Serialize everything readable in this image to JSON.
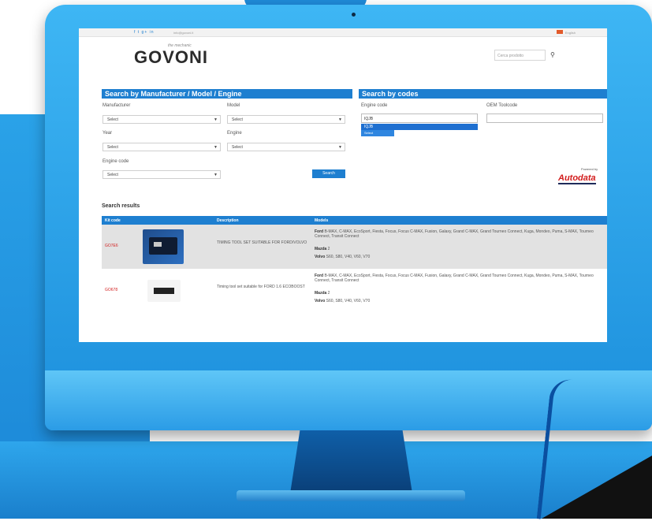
{
  "topbar": {
    "social_icons": "f t g+ in",
    "contact_text": "info@govoni.it",
    "language_text": "English"
  },
  "header": {
    "logo_text": "GOVONI",
    "logo_tagline": "the mechanic",
    "search_placeholder": "Cerca prodotto"
  },
  "search_manufacturer": {
    "title": "Search by Manufacturer / Model / Engine",
    "manufacturer_label": "Manufacturer",
    "manufacturer_value": "Select",
    "model_label": "Model",
    "model_value": "Select",
    "year_label": "Year",
    "year_value": "Select",
    "engine_label": "Engine",
    "engine_value": "Select",
    "engine_code_label": "Engine code",
    "engine_code_value": "Select",
    "search_button": "Search"
  },
  "search_codes": {
    "title": "Search by codes",
    "engine_code_label": "Engine code",
    "engine_code_value": "IQJB",
    "suggestion_1": "IQJB",
    "suggestion_2": "Select",
    "oem_label": "OEM Toolcode",
    "oem_value": "",
    "powered_by": "Powered by",
    "autodata_logo": "Autodata"
  },
  "results": {
    "title": "Search results",
    "columns": [
      "Kit code",
      "Description",
      "Models"
    ],
    "rows": [
      {
        "code": "GO7E6",
        "description": "TIMING TOOL SET SUITABLE FOR FORD/VOLVO",
        "ford_label": "Ford",
        "ford_models": "B-MAX, C-MAX, EcoSport, Fiesta, Focus, Focus C-MAX, Fusion, Galaxy, Grand C-MAX, Grand Tourneo Connect, Kuga, Mondeo, Puma, S-MAX, Tourneo Connect, Transit Connect",
        "mazda_label": "Mazda",
        "mazda_models": "2",
        "volvo_label": "Volvo",
        "volvo_models": "S60, S80, V40, V60, V70"
      },
      {
        "code": "GO678",
        "description": "Timing tool set suitable for FORD 1.6 ECOBOOST",
        "ford_label": "Ford",
        "ford_models": "B-MAX, C-MAX, EcoSport, Fiesta, Focus, Focus C-MAX, Fusion, Galaxy, Grand C-MAX, Grand Tourneo Connect, Kuga, Mondeo, Puma, S-MAX, Tourneo Connect, Transit Connect",
        "mazda_label": "Mazda",
        "mazda_models": "2",
        "volvo_label": "Volvo",
        "volvo_models": "S60, S80, V40, V60, V70"
      }
    ]
  }
}
